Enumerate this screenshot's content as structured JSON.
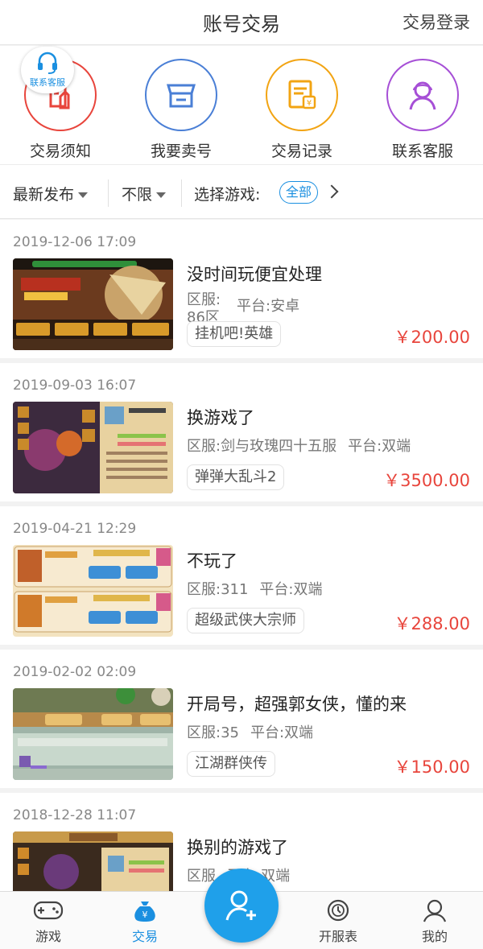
{
  "header": {
    "title": "账号交易",
    "login": "交易登录"
  },
  "shortcuts": [
    {
      "label": "交易须知",
      "icon": "trade-notice-icon",
      "color": "#e8453c"
    },
    {
      "label": "我要卖号",
      "icon": "shop-icon",
      "color": "#4a7fd6"
    },
    {
      "label": "交易记录",
      "icon": "record-icon",
      "color": "#f2a413"
    },
    {
      "label": "联系客服",
      "icon": "support-icon",
      "color": "#a64fd6"
    }
  ],
  "floating_badge": {
    "label": "联系客服",
    "icon": "headset-icon"
  },
  "filters": {
    "sort": "最新发布",
    "limit": "不限",
    "game_label": "选择游戏:",
    "game_value": "全部"
  },
  "listings": [
    {
      "date": "2019-12-06 17:09",
      "title": "没时间玩便宜处理",
      "zone_label": "区服:",
      "zone": "86区",
      "platform": "平台:安卓",
      "game": "挂机吧!英雄",
      "price": "￥200.00"
    },
    {
      "date": "2019-09-03 16:07",
      "title": "换游戏了",
      "zone": "区服:剑与玫瑰四十五服",
      "platform": "平台:双端",
      "game": "弹弹大乱斗2",
      "price": "￥3500.00"
    },
    {
      "date": "2019-04-21 12:29",
      "title": "不玩了",
      "zone": "区服:311",
      "platform": "平台:双端",
      "game": "超级武侠大宗师",
      "price": "￥288.00"
    },
    {
      "date": "2019-02-02 02:09",
      "title": "开局号，超强郭女侠，懂的来",
      "zone": "区服:35",
      "platform": "平台:双端",
      "game": "江湖群侠传",
      "price": "￥150.00"
    },
    {
      "date": "2018-12-28 11:07",
      "title": "换别的游戏了",
      "zone": "区服",
      "platform": "平台:双端"
    }
  ],
  "tabbar": {
    "items": [
      {
        "label": "游戏",
        "icon": "gamepad-icon"
      },
      {
        "label": "交易",
        "icon": "money-bag-icon",
        "active": true
      },
      {
        "label": "开服表",
        "icon": "server-clock-icon"
      },
      {
        "label": "我的",
        "icon": "user-icon"
      }
    ],
    "fab_icon": "add-user-icon"
  },
  "colors": {
    "accent": "#1a8fe0",
    "price": "#e8453c",
    "fab": "#1fa0ea"
  }
}
